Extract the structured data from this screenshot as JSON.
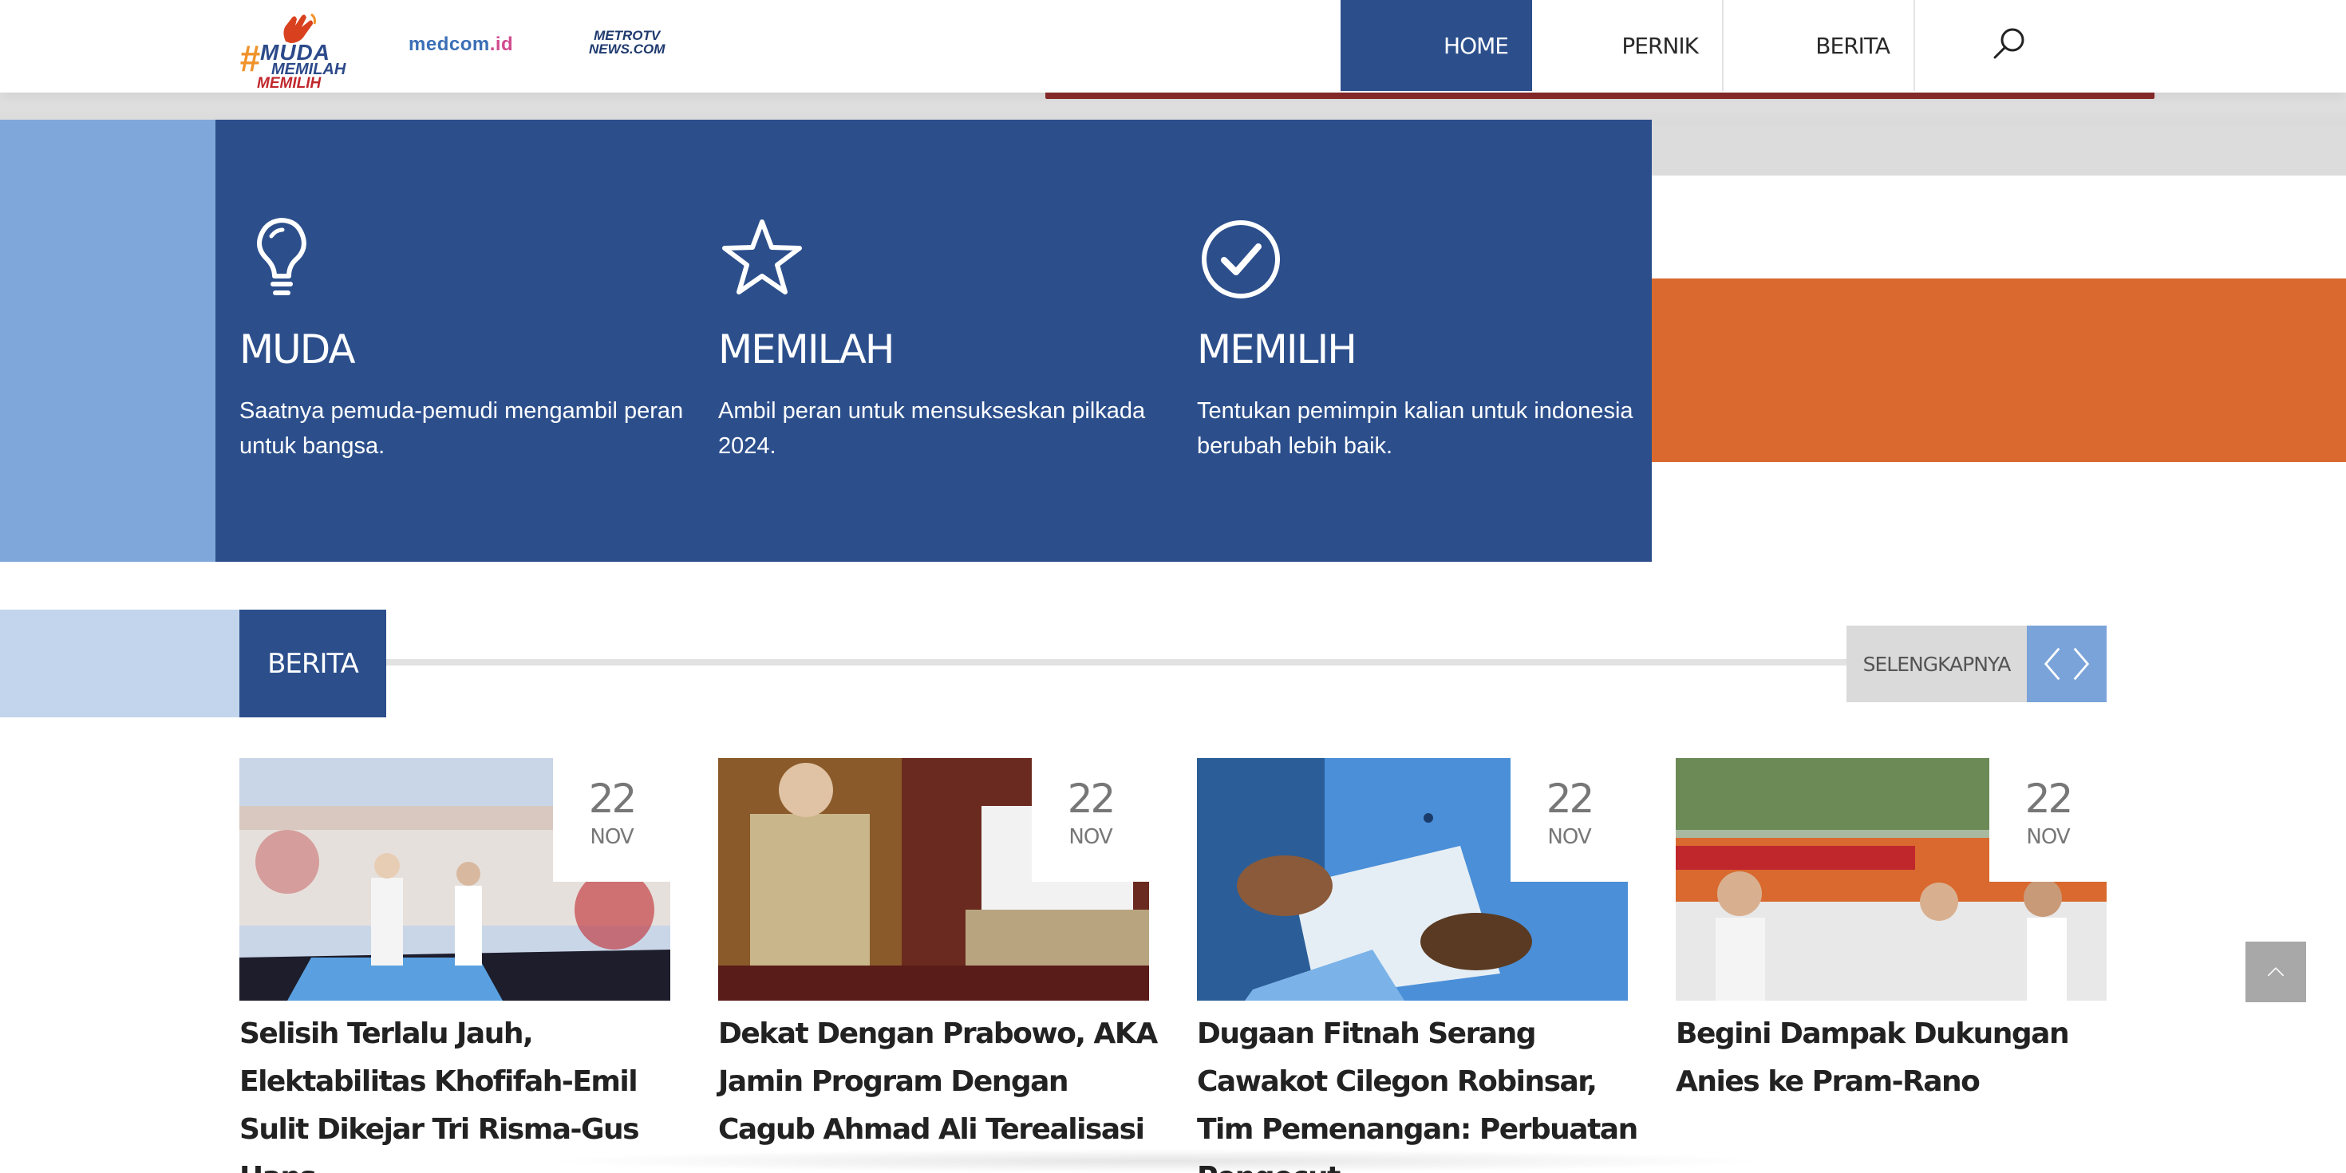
{
  "header": {
    "logos": {
      "muda_hash": "#",
      "muda_line1": "MUDA",
      "muda_line2": "MEMILAH",
      "muda_line3": "MEMILIH",
      "medcom_main": "medcom",
      "medcom_suffix": ".id",
      "metro_line1": "METROTV",
      "metro_line2": "NEWS.COM"
    },
    "nav": [
      {
        "label": "HOME",
        "active": true
      },
      {
        "label": "PERNIK",
        "active": false
      },
      {
        "label": "BERITA",
        "active": false
      }
    ],
    "search_icon": "search-icon"
  },
  "hero": {
    "features": [
      {
        "icon": "lightbulb-icon",
        "title": "MUDA",
        "text": "Saatnya pemuda-pemudi mengambil peran untuk bangsa."
      },
      {
        "icon": "star-icon",
        "title": "MEMILAH",
        "text": "Ambil peran untuk mensukseskan pilkada 2024."
      },
      {
        "icon": "check-circle-icon",
        "title": "MEMILIH",
        "text": "Tentukan pemimpin kalian untuk indonesia berubah lebih baik."
      }
    ]
  },
  "berita": {
    "section_label": "BERITA",
    "more_label": "SELENGKAPNYA",
    "articles": [
      {
        "day": "22",
        "month": "NOV",
        "title": "Selisih Terlalu Jauh, Elektabilitas Khofifah-Emil Sulit Dikejar Tri Risma-Gus Hans"
      },
      {
        "day": "22",
        "month": "NOV",
        "title": "Dekat Dengan Prabowo, AKA Jamin Program Dengan Cagub Ahmad Ali Terealisasi"
      },
      {
        "day": "22",
        "month": "NOV",
        "title": "Dugaan Fitnah Serang Cawakot Cilegon Robinsar, Tim Pemenangan: Perbuatan Pengecut"
      },
      {
        "day": "22",
        "month": "NOV",
        "title": "Begini Dampak Dukungan Anies ke Pram-Rano"
      }
    ]
  },
  "colors": {
    "primary_blue": "#2c4f8c",
    "light_blue": "#80a7d9",
    "pale_blue": "#c3d5ec",
    "orange": "#d9692e"
  }
}
